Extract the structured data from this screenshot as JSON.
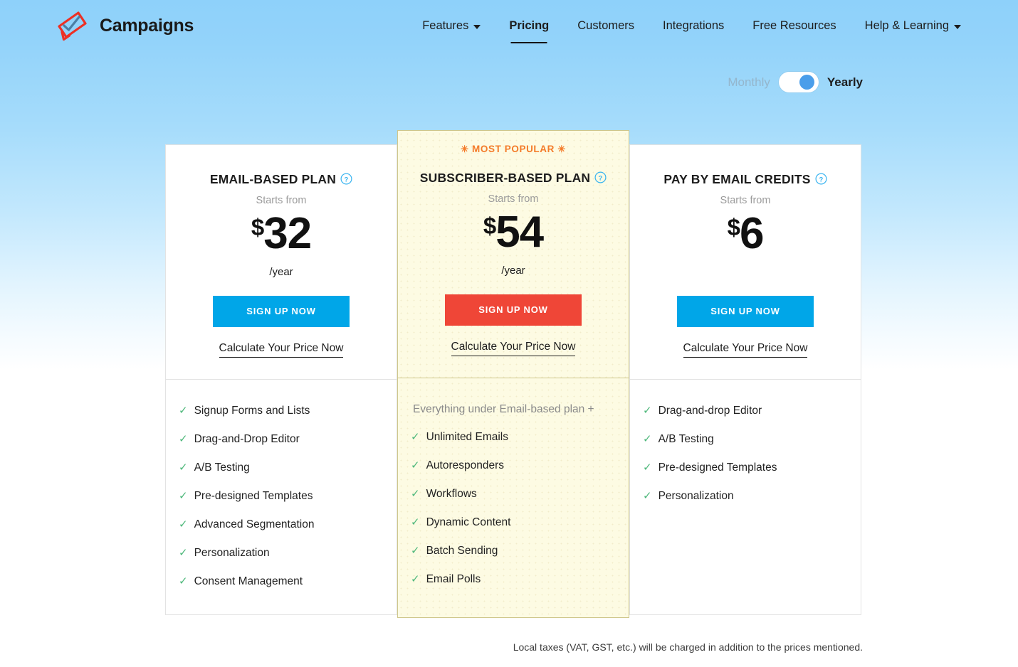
{
  "header": {
    "brand": {
      "name": "Campaigns",
      "logo_icon": "megaphone-check-icon"
    },
    "nav": [
      {
        "label": "Features",
        "has_caret": true,
        "active": false
      },
      {
        "label": "Pricing",
        "has_caret": false,
        "active": true
      },
      {
        "label": "Customers",
        "has_caret": false,
        "active": false
      },
      {
        "label": "Integrations",
        "has_caret": false,
        "active": false
      },
      {
        "label": "Free Resources",
        "has_caret": false,
        "active": false
      },
      {
        "label": "Help & Learning",
        "has_caret": true,
        "active": false
      }
    ]
  },
  "billing_toggle": {
    "monthly_label": "Monthly",
    "yearly_label": "Yearly",
    "selected": "Yearly"
  },
  "plans": [
    {
      "badge": "",
      "title": "EMAIL-BASED PLAN",
      "help_icon": "help-circle-icon",
      "starts_from": "Starts from",
      "currency": "$",
      "amount": "32",
      "period": "/year",
      "cta_label": "SIGN UP NOW",
      "cta_color": "#00a6e8",
      "calc_label": "Calculate Your Price Now",
      "note": "",
      "features": [
        "Signup Forms and Lists",
        "Drag-and-Drop Editor",
        "A/B Testing",
        "Pre-designed Templates",
        "Advanced Segmentation",
        "Personalization",
        "Consent Management"
      ]
    },
    {
      "badge": "MOST POPULAR",
      "title": "SUBSCRIBER-BASED PLAN",
      "help_icon": "help-circle-icon",
      "starts_from": "Starts from",
      "currency": "$",
      "amount": "54",
      "period": "/year",
      "cta_label": "SIGN UP NOW",
      "cta_color": "#ef4637",
      "calc_label": "Calculate Your Price Now",
      "note": "Everything under Email-based plan +",
      "features": [
        "Unlimited Emails",
        "Autoresponders",
        "Workflows",
        "Dynamic Content",
        "Batch Sending",
        "Email Polls"
      ]
    },
    {
      "badge": "",
      "title": "PAY BY EMAIL CREDITS",
      "help_icon": "help-circle-icon",
      "starts_from": "Starts from",
      "currency": "$",
      "amount": "6",
      "period": "",
      "cta_label": "SIGN UP NOW",
      "cta_color": "#00a6e8",
      "calc_label": "Calculate Your Price Now",
      "note": "",
      "features": [
        "Drag-and-drop Editor",
        "A/B Testing",
        "Pre-designed Templates",
        "Personalization"
      ]
    }
  ],
  "footnote": "Local taxes (VAT, GST, etc.) will be charged in addition to the prices mentioned.",
  "colors": {
    "page_top": "#8ed1fa",
    "accent_blue": "#00a6e8",
    "accent_red": "#ef4637",
    "popular_orange": "#f47b29",
    "check_green": "#4eb87b",
    "featured_bg": "#fdfbe3",
    "featured_border": "#cfc78c",
    "toggle_knob": "#4a9eea"
  }
}
